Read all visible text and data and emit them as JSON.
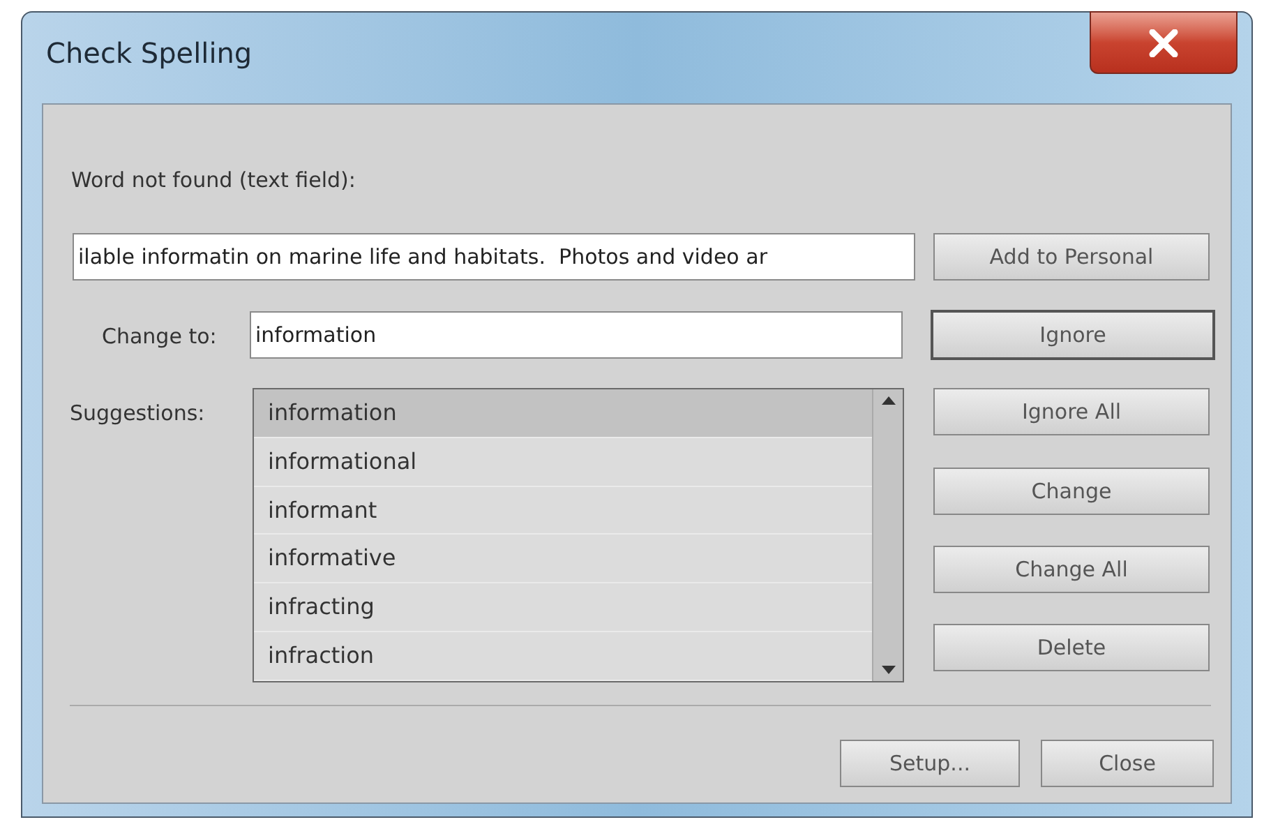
{
  "window": {
    "title": "Check Spelling"
  },
  "word_not_found": {
    "label": "Word not found (text field):",
    "value": "ilable informatin on marine life and habitats.  Photos and video ar"
  },
  "change_to": {
    "label": "Change to:",
    "value": "information"
  },
  "suggestions": {
    "label": "Suggestions:",
    "items": [
      {
        "text": "information",
        "selected": true
      },
      {
        "text": "informational",
        "selected": false
      },
      {
        "text": "informant",
        "selected": false
      },
      {
        "text": "informative",
        "selected": false
      },
      {
        "text": "infracting",
        "selected": false
      },
      {
        "text": "infraction",
        "selected": false
      }
    ]
  },
  "side_buttons": [
    {
      "label": "Add to Personal",
      "default": false
    },
    {
      "label": "Ignore",
      "default": true
    },
    {
      "label": "Ignore All",
      "default": false
    },
    {
      "label": "Change",
      "default": false
    },
    {
      "label": "Change All",
      "default": false
    },
    {
      "label": "Delete",
      "default": false
    }
  ],
  "bottom_buttons": [
    "Setup...",
    "Close"
  ]
}
